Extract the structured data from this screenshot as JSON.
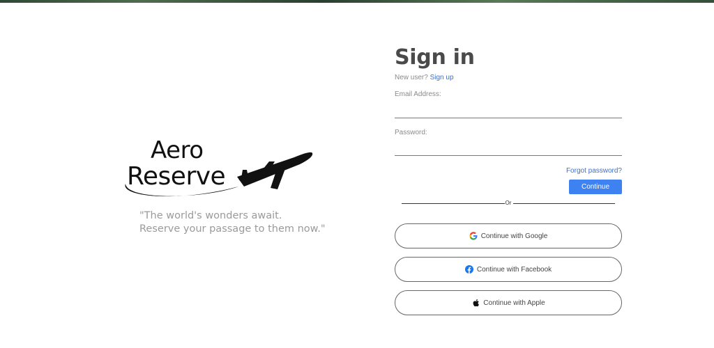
{
  "brand": {
    "word_top": "Aero",
    "word_bottom": "Reserve",
    "logo_icon": "airplane-icon"
  },
  "tagline": {
    "line1": "\"The world's wonders await.",
    "line2": "Reserve your passage to them now.\""
  },
  "signin": {
    "title": "Sign in",
    "new_user_prompt": "New user?",
    "signup_link": "Sign up",
    "email_label": "Email Address:",
    "email_value": "",
    "password_label": "Password:",
    "password_value": "",
    "forgot_link": "Forgot password?",
    "continue_label": "Continue",
    "divider_text": "Or"
  },
  "social": [
    {
      "label": "Continue with Google",
      "icon": "google-icon"
    },
    {
      "label": "Continue with Facebook",
      "icon": "facebook-icon"
    },
    {
      "label": "Continue with Apple",
      "icon": "apple-icon"
    }
  ],
  "colors": {
    "accent": "#3d82f0",
    "link": "#3a6fd0",
    "title": "#4a4a4a",
    "muted": "#8a8a8a",
    "facebook": "#1877f2"
  }
}
